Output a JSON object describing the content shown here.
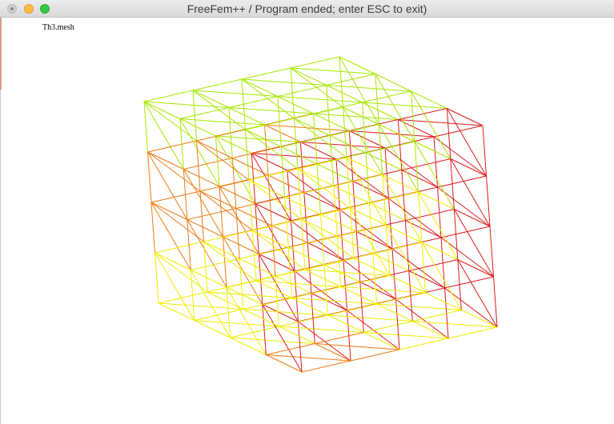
{
  "window": {
    "title": "FreeFem++ / Program ended; enter ESC to exit)"
  },
  "plot": {
    "label": "Th3.mesh"
  },
  "colors": {
    "edge_red": "#e01a1a",
    "edge_orange": "#f07a10",
    "edge_yellow": "#eeee00",
    "edge_green": "#a8e600",
    "traffic_close": "#d0d0d0",
    "traffic_min": "#fdbc40",
    "traffic_max": "#33c748"
  }
}
